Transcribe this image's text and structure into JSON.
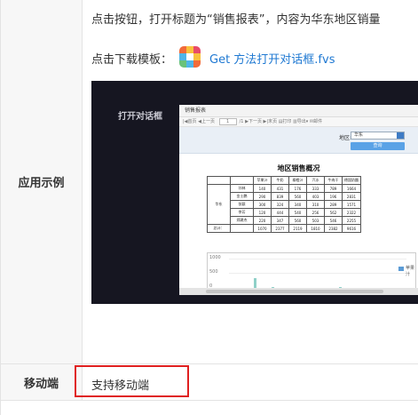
{
  "rows": {
    "example": {
      "label": "应用示例",
      "line1": "点击按钮，打开标题为“销售报表”，内容为华东地区销量",
      "download_prefix": "点击下载模板：",
      "download_link": "Get 方法打开对话框.fvs"
    },
    "mobile": {
      "label": "移动端",
      "value": "支持移动端"
    }
  },
  "screenshot": {
    "panel_title": "打开对话框",
    "dialog_title": "销售报表",
    "toolbar": {
      "first": "首页",
      "prev": "上一页",
      "page": "1",
      "total": "/1",
      "next": "下一页",
      "last": "末页",
      "print": "打印",
      "export": "导出",
      "email": "邮件"
    },
    "param_label": "地区:",
    "param_value": "华东",
    "query_label": "查询",
    "report_title": "地区销售概况",
    "table": {
      "header": [
        "",
        "",
        "苹果汁",
        "牛奶",
        "柳橙汁",
        "汽水",
        "牛肉干",
        "德国奶酪"
      ],
      "region": "华东",
      "rows": [
        [
          "",
          "孙林",
          "140",
          "431",
          "176",
          "333",
          "789",
          "1664"
        ],
        [
          "",
          "金士鹏",
          "290",
          "839",
          "560",
          "403",
          "196",
          "2831"
        ],
        [
          "",
          "张颖",
          "300",
          "324",
          "340",
          "310",
          "289",
          "1571"
        ],
        [
          "",
          "李芳",
          "120",
          "444",
          "540",
          "256",
          "562",
          "2322"
        ],
        [
          "",
          "郑建杰",
          "220",
          "347",
          "560",
          "503",
          "546",
          "2255"
        ]
      ],
      "total": [
        "总计：",
        "",
        "1070",
        "2377",
        "2119",
        "1810",
        "2382",
        "9616"
      ]
    },
    "chart": {
      "yticks": [
        "1000",
        "500",
        "0"
      ],
      "legend": "苹果汁"
    }
  }
}
